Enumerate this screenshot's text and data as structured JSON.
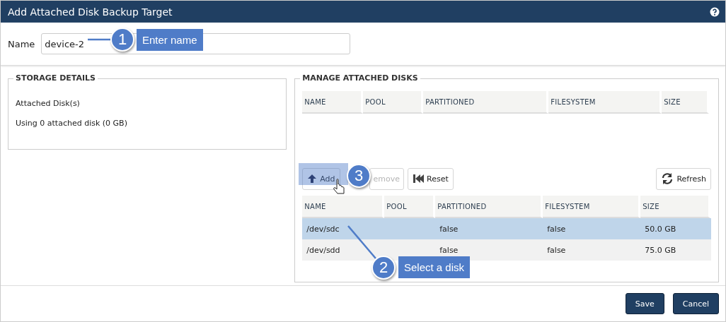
{
  "dialog": {
    "title": "Add Attached Disk Backup Target"
  },
  "name_field": {
    "label": "Name",
    "value": "device-2"
  },
  "storage_details": {
    "title": "STORAGE DETAILS",
    "lines": [
      "Attached Disk(s)",
      "Using 0 attached disk (0 GB)"
    ]
  },
  "manage": {
    "title": "MANAGE ATTACHED DISKS",
    "attached_table": {
      "columns": [
        "NAME",
        "POOL",
        "PARTITIONED",
        "FILESYSTEM",
        "SIZE"
      ]
    },
    "buttons": [
      {
        "label": "Add",
        "kind": "add",
        "disabled": false
      },
      {
        "label": "emove",
        "kind": "remove",
        "disabled": true
      },
      {
        "label": "Reset",
        "kind": "reset",
        "disabled": false
      },
      {
        "label": "Refresh",
        "kind": "refresh",
        "disabled": false
      }
    ],
    "available_table": {
      "columns": [
        "NAME",
        "POOL",
        "PARTITIONED",
        "FILESYSTEM",
        "SIZE"
      ],
      "rows": [
        {
          "name": "/dev/sdc",
          "partitioned": "false",
          "filesystem": "false",
          "size": "50.0 GB",
          "selected": true
        },
        {
          "name": "/dev/sdd",
          "partitioned": "false",
          "filesystem": "false",
          "size": "75.0 GB",
          "selected": false
        }
      ]
    }
  },
  "callouts": [
    {
      "number": "1",
      "text": "Enter name"
    },
    {
      "number": "2",
      "text": "Select a disk"
    },
    {
      "number": "3"
    }
  ],
  "footer_buttons": [
    "Save",
    "Cancel"
  ]
}
